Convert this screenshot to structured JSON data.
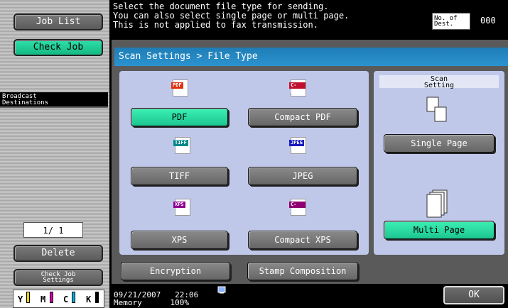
{
  "sidebar": {
    "job_list": "Job List",
    "check_job": "Check Job",
    "broadcast_line1": "Broadcast",
    "broadcast_line2": "Destinations",
    "page_counter": "1/  1",
    "delete": "Delete",
    "check_job_settings_line1": "Check Job",
    "check_job_settings_line2": "Settings"
  },
  "toner": {
    "y": "Y",
    "m": "M",
    "c": "C",
    "k": "K",
    "colors": {
      "y": "#e8d400",
      "m": "#d400b0",
      "c": "#00b0e0",
      "k": "#000000"
    }
  },
  "message": {
    "line1": "Select the document file type for sending.",
    "line2": "You can also select single page or multi page.",
    "line3": "This is not applied to fax transmission."
  },
  "destinations": {
    "label_line1": "No. of",
    "label_line2": "Dest.",
    "count": "000"
  },
  "breadcrumb": "Scan Settings > File Type",
  "file_types": {
    "pdf": {
      "label": "PDF",
      "icon_text": "PDF",
      "icon_color": "#e03010"
    },
    "compact_pdf": {
      "label": "Compact PDF",
      "icon_text": "C-PDF",
      "icon_color": "#c01030"
    },
    "tiff": {
      "label": "TIFF",
      "icon_text": "TIFF",
      "icon_color": "#008a8a"
    },
    "jpeg": {
      "label": "JPEG",
      "icon_text": "JPEG",
      "icon_color": "#1a1ac0"
    },
    "xps": {
      "label": "XPS",
      "icon_text": "XPS",
      "icon_color": "#900090"
    },
    "compact_xps": {
      "label": "Compact XPS",
      "icon_text": "C-XPS",
      "icon_color": "#900070"
    }
  },
  "scan_setting": {
    "title_line1": "Scan",
    "title_line2": "Setting",
    "single_page": "Single Page",
    "multi_page": "Multi Page"
  },
  "actions": {
    "encryption": "Encryption",
    "stamp_composition": "Stamp Composition",
    "ok": "OK"
  },
  "status": {
    "date": "09/21/2007",
    "time": "22:06",
    "memory_label": "Memory",
    "memory_value": "100%"
  },
  "colors": {
    "selected": "#1cc690",
    "breadcrumb": "#2b93d0",
    "panel": "#c0c8ea"
  }
}
